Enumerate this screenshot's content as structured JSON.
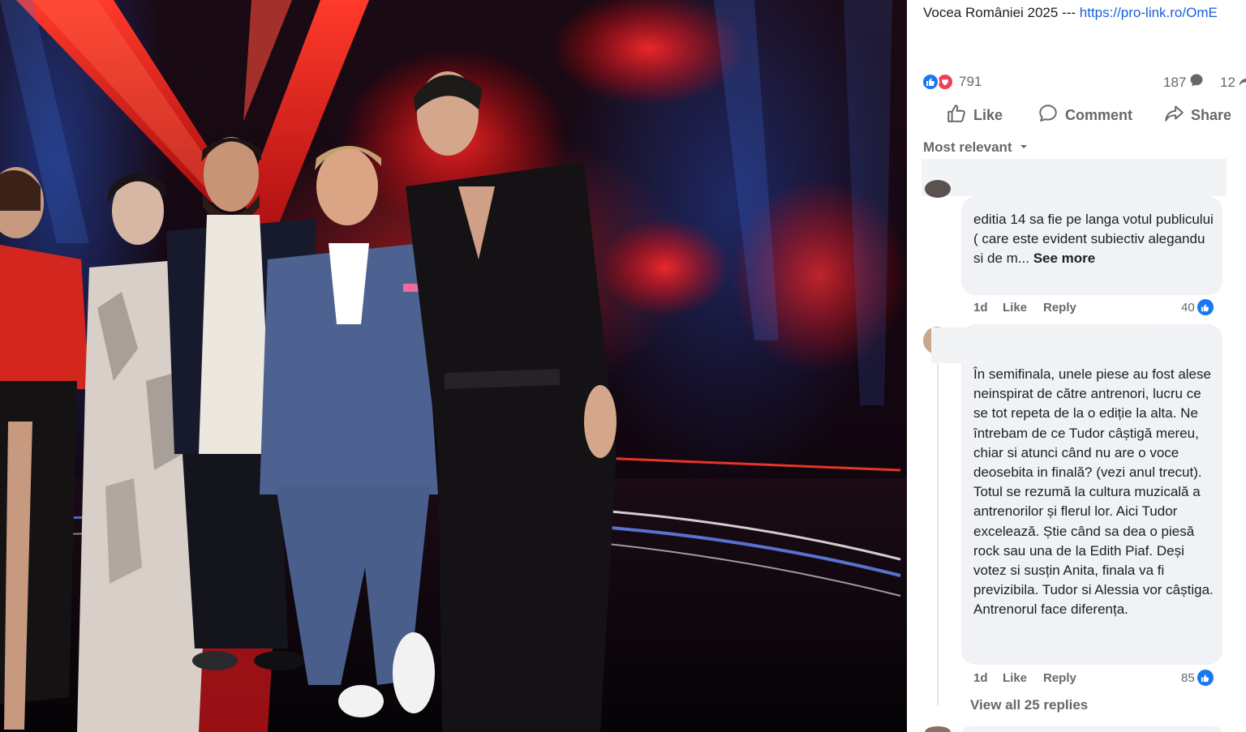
{
  "post": {
    "text": "Vocea României 2025 --- ",
    "link_text": "https://pro-link.ro/OmE"
  },
  "reactions": {
    "types": [
      "like",
      "love"
    ],
    "count": "791",
    "comments": "187",
    "shares": "12"
  },
  "actions": {
    "like": "Like",
    "comment": "Comment",
    "share": "Share"
  },
  "sort": {
    "label": "Most relevant"
  },
  "comments": [
    {
      "text": "editia 14 sa fie pe langa votul publicului ( care este evident subiectiv alegandu si de m... ",
      "see_more": "See more",
      "time": "1d",
      "like": "Like",
      "reply": "Reply",
      "likes": "40"
    },
    {
      "text": "În semifinala, unele piese au fost alese neinspirat de către antrenori, lucru ce se tot repeta de la o ediție la alta. Ne întrebam de ce Tudor câștigă mereu, chiar si atunci când nu are o voce deosebita in finală? (vezi anul trecut). Totul se rezumă la cultura muzicală a antrenorilor și flerul lor. Aici Tudor excelează. Știe când sa dea o piesă rock sau una de la Edith Piaf. Deși votez si susțin Anita, finala va fi previzibila. Tudor si Alessia vor câștiga. Antrenorul face diferența.",
      "time": "1d",
      "like": "Like",
      "reply": "Reply",
      "likes": "85"
    }
  ],
  "view_replies": "View all 25 replies",
  "colors": {
    "accent": "#1877f2",
    "love": "#f33e58",
    "link": "#1a5fd6",
    "muted": "#65676b",
    "bubble": "#f0f2f5"
  }
}
